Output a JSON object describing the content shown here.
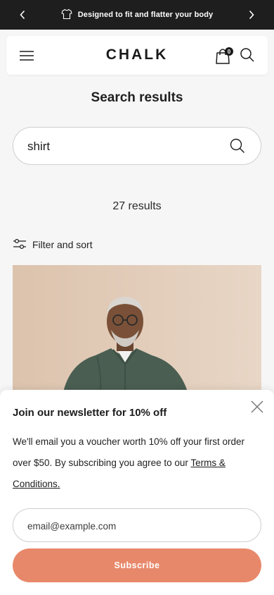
{
  "announcement": {
    "text": "Designed to fit and flatter your body",
    "icon": "tshirt-icon",
    "prev_icon": "chevron-left-icon",
    "next_icon": "chevron-right-icon",
    "background": "#1e1e1e"
  },
  "header": {
    "logo": "CHALK",
    "cart_count": "0",
    "menu_icon": "hamburger-menu-icon",
    "cart_icon": "shopping-bag-icon",
    "search_icon": "search-icon"
  },
  "page": {
    "title": "Search results"
  },
  "search": {
    "value": "shirt",
    "button_icon": "search-icon"
  },
  "results": {
    "count_text": "27 results"
  },
  "filter": {
    "label": "Filter and sort",
    "icon": "sliders-icon"
  },
  "product": {
    "image": "man-in-green-shirt-photo"
  },
  "newsletter": {
    "title": "Join our newsletter for 10% off",
    "description": "We'll email you a voucher worth 10% off your first order over $50. By subscribing you agree to our",
    "terms_link": "Terms & Conditions.",
    "email_placeholder": "email@example.com",
    "subscribe_label": "Subscribe",
    "close_icon": "close-icon",
    "accent": "#e8886a"
  }
}
